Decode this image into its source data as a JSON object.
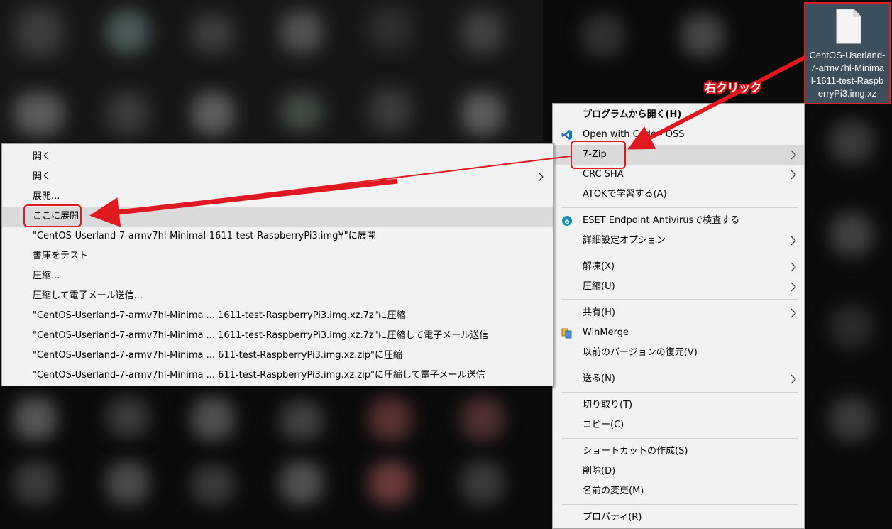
{
  "desktop_file": {
    "name": "CentOS-Userland-7-armv7hl-Minimal-1611-test-RaspberryPi3.img.xz",
    "name_lines": [
      "CentOS-Userland-",
      "7-armv7hl-Minima",
      "l-1611-test-Raspb",
      "erryPi3.img.xz"
    ]
  },
  "annotation": {
    "right_click_label": "右クリック"
  },
  "context_menu": {
    "items": [
      {
        "label": "プログラムから開く(H)",
        "bold": true
      },
      {
        "label": "Open with Code - OSS",
        "icon": "vscode-icon"
      },
      {
        "label": "7-Zip",
        "submenu": true,
        "highlighted": true
      },
      {
        "label": "CRC SHA",
        "submenu": true
      },
      {
        "label": "ATOKで学習する(A)"
      },
      {
        "label": "ESET Endpoint Antivirusで検査する",
        "icon": "eset-icon"
      },
      {
        "label": "詳細設定オプション",
        "submenu": true
      },
      {
        "label": "解凍(X)",
        "submenu": true
      },
      {
        "label": "圧縮(U)",
        "submenu": true
      },
      {
        "label": "共有(H)",
        "submenu": true
      },
      {
        "label": "WinMerge",
        "icon": "winmerge-icon"
      },
      {
        "label": "以前のバージョンの復元(V)"
      },
      {
        "label": "送る(N)",
        "submenu": true
      },
      {
        "label": "切り取り(T)"
      },
      {
        "label": "コピー(C)"
      },
      {
        "label": "ショートカットの作成(S)"
      },
      {
        "label": "削除(D)"
      },
      {
        "label": "名前の変更(M)"
      },
      {
        "label": "プロパティ(R)"
      }
    ]
  },
  "zip_submenu": {
    "items": [
      {
        "label": "開く"
      },
      {
        "label": "開く",
        "submenu": true
      },
      {
        "label": "展開..."
      },
      {
        "label": "ここに展開",
        "highlighted": true
      },
      {
        "label": "\"CentOS-Userland-7-armv7hl-Minimal-1611-test-RaspberryPi3.img¥\"に展開"
      },
      {
        "label": "書庫をテスト"
      },
      {
        "label": "圧縮..."
      },
      {
        "label": "圧縮して電子メール送信..."
      },
      {
        "label": "\"CentOS-Userland-7-armv7hl-Minima ... 1611-test-RaspberryPi3.img.xz.7z\"に圧縮"
      },
      {
        "label": "\"CentOS-Userland-7-armv7hl-Minima ... 1611-test-RaspberryPi3.img.xz.7z\"に圧縮して電子メール送信"
      },
      {
        "label": "\"CentOS-Userland-7-armv7hl-Minima ... 611-test-RaspberryPi3.img.xz.zip\"に圧縮"
      },
      {
        "label": "\"CentOS-Userland-7-armv7hl-Minima ... 611-test-RaspberryPi3.img.xz.zip\"に圧縮して電子メール送信"
      }
    ]
  },
  "colors": {
    "accent_red": "#e0181f",
    "menu_bg": "#f2f2f2",
    "highlight": "#dadada"
  }
}
